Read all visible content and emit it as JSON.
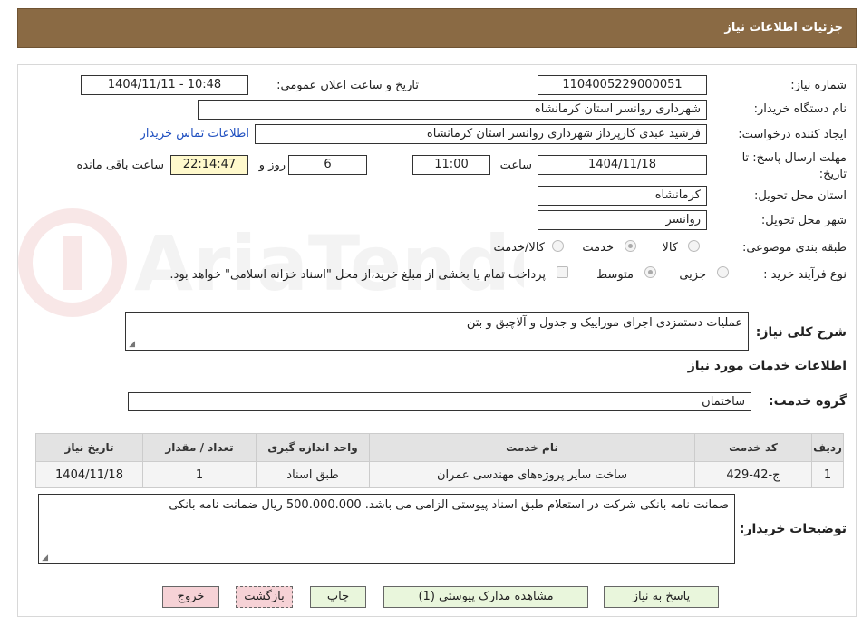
{
  "header": {
    "title": "جزئیات اطلاعات نیاز"
  },
  "form": {
    "need_number_label": "شماره نیاز:",
    "need_number": "1104005229000051",
    "announce_label": "تاریخ و ساعت اعلان عمومی:",
    "announce_value": "1404/11/11 - 10:48",
    "buyer_org_label": "نام دستگاه خریدار:",
    "buyer_org": "شهرداری روانسر استان کرمانشاه",
    "creator_label": "ایجاد کننده درخواست:",
    "creator": "فرشید عبدی کارپرداز شهرداری روانسر استان کرمانشاه",
    "contact_link": "اطلاعات تماس خریدار",
    "deadline_label": "مهلت ارسال پاسخ: تا تاریخ:",
    "deadline_date": "1404/11/18",
    "time_label": "ساعت",
    "deadline_time": "11:00",
    "days_value": "6",
    "days_label": "روز و",
    "remaining_time": "22:14:47",
    "remaining_label": "ساعت باقی مانده",
    "province_label": "استان محل تحویل:",
    "province": "کرمانشاه",
    "city_label": "شهر محل تحویل:",
    "city": "روانسر",
    "category_label": "طبقه بندی موضوعی:",
    "category_options": [
      "کالا",
      "خدمت",
      "کالا/خدمت"
    ],
    "category_selected": "خدمت",
    "process_label": "نوع فرآیند خرید :",
    "process_options": [
      "جزیی",
      "متوسط"
    ],
    "process_selected": "متوسط",
    "payment_note": "پرداخت تمام یا بخشی از مبلغ خرید،از محل \"اسناد خزانه اسلامی\" خواهد بود.",
    "summary_label": "شرح کلی نیاز:",
    "summary": "عملیات دستمزدی اجرای موزاییک و جدول و آلاچیق و بتن",
    "services_heading": "اطلاعات خدمات مورد نیاز",
    "service_group_label": "گروه خدمت:",
    "service_group": "ساختمان"
  },
  "table": {
    "headers": [
      "ردیف",
      "کد خدمت",
      "نام خدمت",
      "واحد اندازه گیری",
      "تعداد / مقدار",
      "تاریخ نیاز"
    ],
    "rows": [
      [
        "1",
        "ج-42-429",
        "ساخت سایر پروژه‌های مهندسی عمران",
        "طبق اسناد",
        "1",
        "1404/11/18"
      ]
    ]
  },
  "buyer_notes": {
    "label": "توضیحات خریدار:",
    "text": "ضمانت نامه بانکی شرکت در استعلام طبق اسناد پیوستی الزامی می باشد. 500.000.000 ریال ضمانت نامه بانکی"
  },
  "buttons": {
    "reply": "پاسخ به نیاز",
    "attachments": "مشاهده مدارک پیوستی (1)",
    "print": "چاپ",
    "back": "بازگشت",
    "exit": "خروج"
  },
  "watermark": {
    "text": "AriaTender.net"
  },
  "colors": {
    "title_bar": "#8a6a44",
    "link": "#2050c0",
    "time_bg": "#fff9cc",
    "btn_green": "#e9f6dc",
    "btn_red": "#f6d2d6"
  }
}
